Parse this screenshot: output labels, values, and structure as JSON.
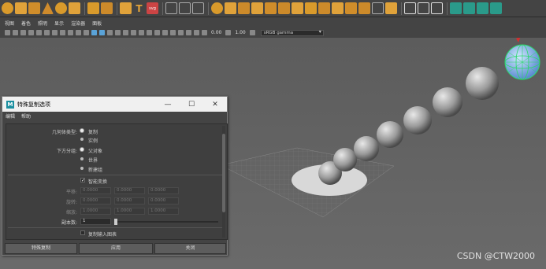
{
  "menubar": [
    "视图",
    "着色",
    "照明",
    "显示",
    "渲染器",
    "面板"
  ],
  "toolbar": {
    "exposure": "0.00",
    "gamma": "1.00",
    "color_space": "sRGB gamma"
  },
  "dialog": {
    "title": "特殊复制选项",
    "menu": [
      "编辑",
      "帮助"
    ],
    "geometry_type_label": "几何体类型:",
    "geometry_options": [
      "复制",
      "实例"
    ],
    "group_under_label": "下方分组:",
    "group_options": [
      "父对象",
      "世界",
      "新建组"
    ],
    "smart_transform_label": "智能变换",
    "translate_label": "平移:",
    "rotate_label": "旋转:",
    "scale_label": "缩放:",
    "translate_values": [
      "0.0000",
      "0.0000",
      "0.0000"
    ],
    "rotate_values": [
      "0.0000",
      "0.0000",
      "0.0000"
    ],
    "scale_values": [
      "1.0000",
      "1.0000",
      "1.0000"
    ],
    "copies_label": "副本数:",
    "copies_value": "1",
    "copies_fraction": 0.0,
    "duplicate_input_graph_label": "复制输入图表",
    "buttons": [
      "特殊复制",
      "应用",
      "关闭"
    ],
    "window_controls": [
      "—",
      "☐",
      "✕"
    ]
  },
  "watermark": "CSDN @CTW2000",
  "icons": [
    "sphere-icon",
    "cube-icon",
    "cylinder-icon",
    "cone-icon",
    "torus-icon",
    "text-icon",
    "svg-icon",
    "lattice-icon",
    "uv-icon",
    "camera-icon"
  ],
  "colors": {
    "shelf_bg": "#444444",
    "viewport_top": "#5c5c5c",
    "accent_blue": "#5aa3d8",
    "gizmo_green": "#2bd96b"
  }
}
